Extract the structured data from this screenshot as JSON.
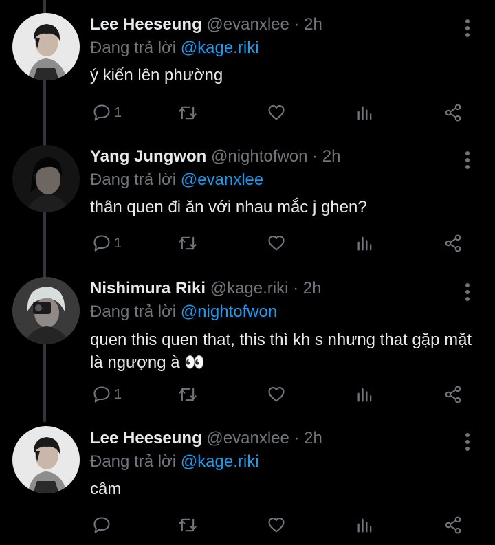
{
  "tweets": [
    {
      "name": "Lee Heeseung",
      "meta": "@evanxlee · 2h",
      "reply_prefix": "Đang trả lời ",
      "reply_to": "@kage.riki",
      "text": "ý kiến lên phường",
      "reply_count": "1"
    },
    {
      "name": "Yang Jungwon",
      "meta": "@nightofwon · 2h",
      "reply_prefix": "Đang trả lời ",
      "reply_to": "@evanxlee",
      "text": "thân quen đi ăn với nhau mắc j ghen?",
      "reply_count": "1"
    },
    {
      "name": "Nishimura Riki",
      "meta": "@kage.riki · 2h",
      "reply_prefix": "Đang trả lời ",
      "reply_to": "@nightofwon",
      "text": "quen this quen that, this thì kh s nhưng that gặp mặt là ngượng à 👀",
      "reply_count": "1"
    },
    {
      "name": "Lee Heeseung",
      "meta": "@evanxlee · 2h",
      "reply_prefix": "Đang trả lời ",
      "reply_to": "@kage.riki",
      "text": "câm",
      "reply_count": ""
    }
  ],
  "icons": {
    "reply": "reply-icon",
    "retweet": "retweet-icon",
    "like": "heart-icon",
    "views": "views-icon",
    "share": "share-icon",
    "more": "more-icon"
  },
  "colors": {
    "background": "#000000",
    "text": "#e7e9ea",
    "muted": "#71767b",
    "mention": "#1d9bf0",
    "thread_line": "#333639"
  }
}
